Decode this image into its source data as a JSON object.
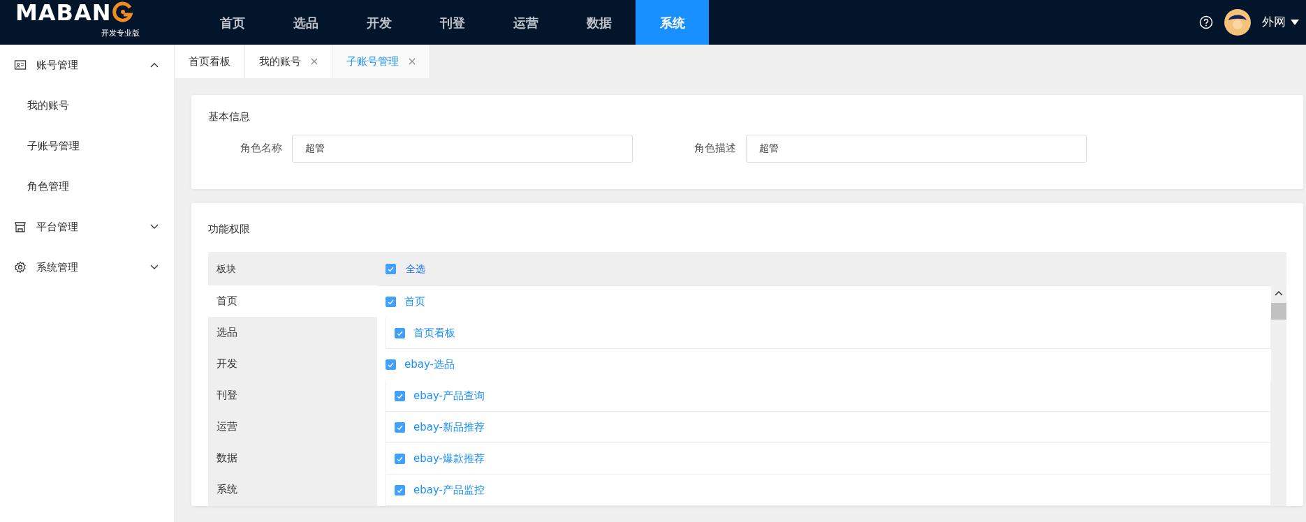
{
  "header": {
    "logo": "MABAN",
    "edition": "开发专业版",
    "nav": [
      {
        "label": "首页",
        "selected": false
      },
      {
        "label": "选品",
        "selected": false
      },
      {
        "label": "开发",
        "selected": false
      },
      {
        "label": "刊登",
        "selected": false
      },
      {
        "label": "运营",
        "selected": false
      },
      {
        "label": "数据",
        "selected": false
      },
      {
        "label": "系统",
        "selected": true
      }
    ],
    "user": "外网"
  },
  "sidebar": {
    "items": [
      {
        "label": "账号管理",
        "expanded": true,
        "children": [
          {
            "label": "我的账号"
          },
          {
            "label": "子账号管理"
          },
          {
            "label": "角色管理"
          }
        ]
      },
      {
        "label": "平台管理",
        "expanded": false
      },
      {
        "label": "系统管理",
        "expanded": false
      }
    ]
  },
  "tabs": [
    {
      "label": "首页看板",
      "selected": false,
      "closable": false
    },
    {
      "label": "我的账号",
      "selected": false,
      "closable": true
    },
    {
      "label": "子账号管理",
      "selected": true,
      "closable": true
    }
  ],
  "basic_info": {
    "title": "基本信息",
    "fields": [
      {
        "label": "角色名称",
        "value": "超管"
      },
      {
        "label": "角色描述",
        "value": "超管"
      }
    ]
  },
  "permissions": {
    "title": "功能权限",
    "column_header": "板块",
    "select_all": {
      "label": "全选",
      "checked": true
    },
    "modules": [
      {
        "label": "首页",
        "selected": true
      },
      {
        "label": "选品",
        "selected": false
      },
      {
        "label": "开发",
        "selected": false
      },
      {
        "label": "刊登",
        "selected": false
      },
      {
        "label": "运营",
        "selected": false
      },
      {
        "label": "数据",
        "selected": false
      },
      {
        "label": "系统",
        "selected": false
      }
    ],
    "entries": [
      {
        "kind": "group",
        "label": "首页",
        "checked": true
      },
      {
        "kind": "item",
        "label": "首页看板",
        "checked": true
      },
      {
        "kind": "group",
        "label": "ebay-选品",
        "checked": true
      },
      {
        "kind": "item",
        "label": "ebay-产品查询",
        "checked": true
      },
      {
        "kind": "item",
        "label": "ebay-新品推荐",
        "checked": true
      },
      {
        "kind": "item",
        "label": "ebay-爆款推荐",
        "checked": true
      },
      {
        "kind": "item",
        "label": "ebay-产品监控",
        "checked": true
      }
    ]
  }
}
